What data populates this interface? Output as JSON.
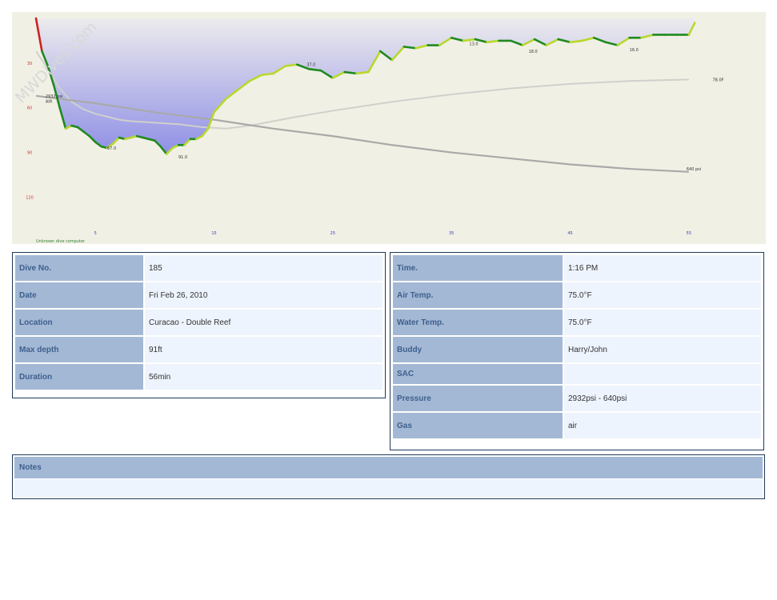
{
  "watermark": "MWDives.com",
  "chart_data": {
    "type": "area",
    "xlim": [
      0,
      60
    ],
    "ylim": [
      0,
      145
    ],
    "y_inverted": true,
    "x_ticks": [
      5,
      15,
      25,
      35,
      45,
      55
    ],
    "y_ticks": [
      30,
      60,
      90,
      120
    ],
    "series": [
      {
        "role": "depth",
        "x": [
          0,
          0.5,
          1,
          1.5,
          2,
          2.5,
          3,
          3.5,
          4,
          4.5,
          5,
          5.5,
          6,
          6.5,
          7,
          7.5,
          8,
          8.5,
          9,
          9.5,
          10,
          10.5,
          11,
          11.5,
          12,
          12.5,
          13,
          13.5,
          14,
          14.5,
          15,
          16,
          17,
          18,
          19,
          20,
          21,
          22,
          23,
          24,
          25,
          26,
          27,
          28,
          29,
          30,
          31,
          32,
          33,
          34,
          35,
          36,
          37,
          38,
          39,
          40,
          41,
          42,
          43,
          44,
          45,
          46,
          47,
          48,
          49,
          50,
          51,
          52,
          53,
          54,
          55,
          55.5
        ],
        "y": [
          0,
          22,
          32,
          45,
          60,
          74,
          72,
          73,
          76,
          79,
          83,
          86,
          87,
          84,
          80,
          81,
          80,
          79,
          80,
          81,
          82,
          86,
          91,
          87,
          85,
          85,
          81,
          81,
          79,
          74,
          63,
          54,
          48,
          42,
          38,
          37,
          32,
          31,
          34,
          35,
          40,
          36,
          37,
          36,
          22,
          28,
          19,
          20,
          18,
          18,
          13,
          15,
          14,
          16,
          15,
          15,
          18,
          14,
          18,
          14,
          16,
          15,
          13,
          16,
          18,
          13,
          13,
          11,
          11,
          11,
          11,
          3
        ]
      },
      {
        "role": "pressure",
        "x": [
          0,
          5,
          10,
          15,
          20,
          25,
          30,
          35,
          40,
          45,
          50,
          55
        ],
        "y": [
          52,
          57,
          63,
          68,
          74,
          79,
          85,
          90,
          94,
          98,
          101,
          103
        ]
      },
      {
        "role": "temperature",
        "x": [
          0,
          1,
          2,
          3,
          4,
          5,
          6,
          7,
          8,
          9,
          10,
          12,
          14,
          16,
          18,
          20,
          22,
          25,
          30,
          35,
          40,
          45,
          50,
          55
        ],
        "y": [
          22,
          34,
          47,
          56,
          61,
          64,
          66,
          68,
          69,
          69.5,
          70,
          71,
          73,
          74,
          72,
          69,
          66,
          62,
          56,
          51,
          47,
          44,
          42,
          41
        ]
      }
    ],
    "annotations": [
      {
        "text": "67.0",
        "x": 6,
        "y": 87
      },
      {
        "text": "91.0",
        "x": 12,
        "y": 93
      },
      {
        "text": "37.0",
        "x": 22.8,
        "y": 31
      },
      {
        "text": "13.0",
        "x": 36.5,
        "y": 17
      },
      {
        "text": "18.0",
        "x": 41.5,
        "y": 22
      },
      {
        "text": "16.0",
        "x": 50,
        "y": 21
      },
      {
        "text": "2932 psi",
        "x": 0.8,
        "y": 52
      },
      {
        "text": "AIR",
        "x": 0.8,
        "y": 55.5
      },
      {
        "text": "640 psi",
        "x": 54.8,
        "y": 101
      },
      {
        "text": "78.0F",
        "x": 57,
        "y": 41
      }
    ],
    "footer": "Unknown dive computer"
  },
  "info_left": [
    {
      "label": "Dive No.",
      "value": "185"
    },
    {
      "label": "Date",
      "value": "Fri Feb 26, 2010"
    },
    {
      "label": "Location",
      "value": "Curacao - Double Reef"
    },
    {
      "label": "Max depth",
      "value": "91ft"
    },
    {
      "label": "Duration",
      "value": "56min"
    }
  ],
  "info_right": [
    {
      "label": "Time.",
      "value": "1:16 PM"
    },
    {
      "label": "Air Temp.",
      "value": "75.0°F"
    },
    {
      "label": "Water Temp.",
      "value": "75.0°F"
    },
    {
      "label": "Buddy",
      "value": "Harry/John"
    },
    {
      "label": "SAC",
      "value": ""
    },
    {
      "label": "Pressure",
      "value": "2932psi - 640psi"
    },
    {
      "label": "Gas",
      "value": "air"
    }
  ],
  "notes": {
    "label": "Notes",
    "value": ""
  },
  "colors": {
    "plot_bg": "#f1f0e5",
    "depth_fill_top": "#ecebed",
    "depth_fill_bottom": "#8f8fe6",
    "depth_line_dark": "#1f8a1f",
    "depth_line_light": "#b8d82c",
    "pressure_line": "#a9a9a9",
    "temperature_line": "#d0d0cc",
    "y_tick": "#cc3333",
    "x_tick": "#3344aa",
    "header_cell": "#a3b8d4",
    "header_text": "#3d5f8e",
    "value_cell": "#eef4fd",
    "border": "#1f3a5c"
  }
}
